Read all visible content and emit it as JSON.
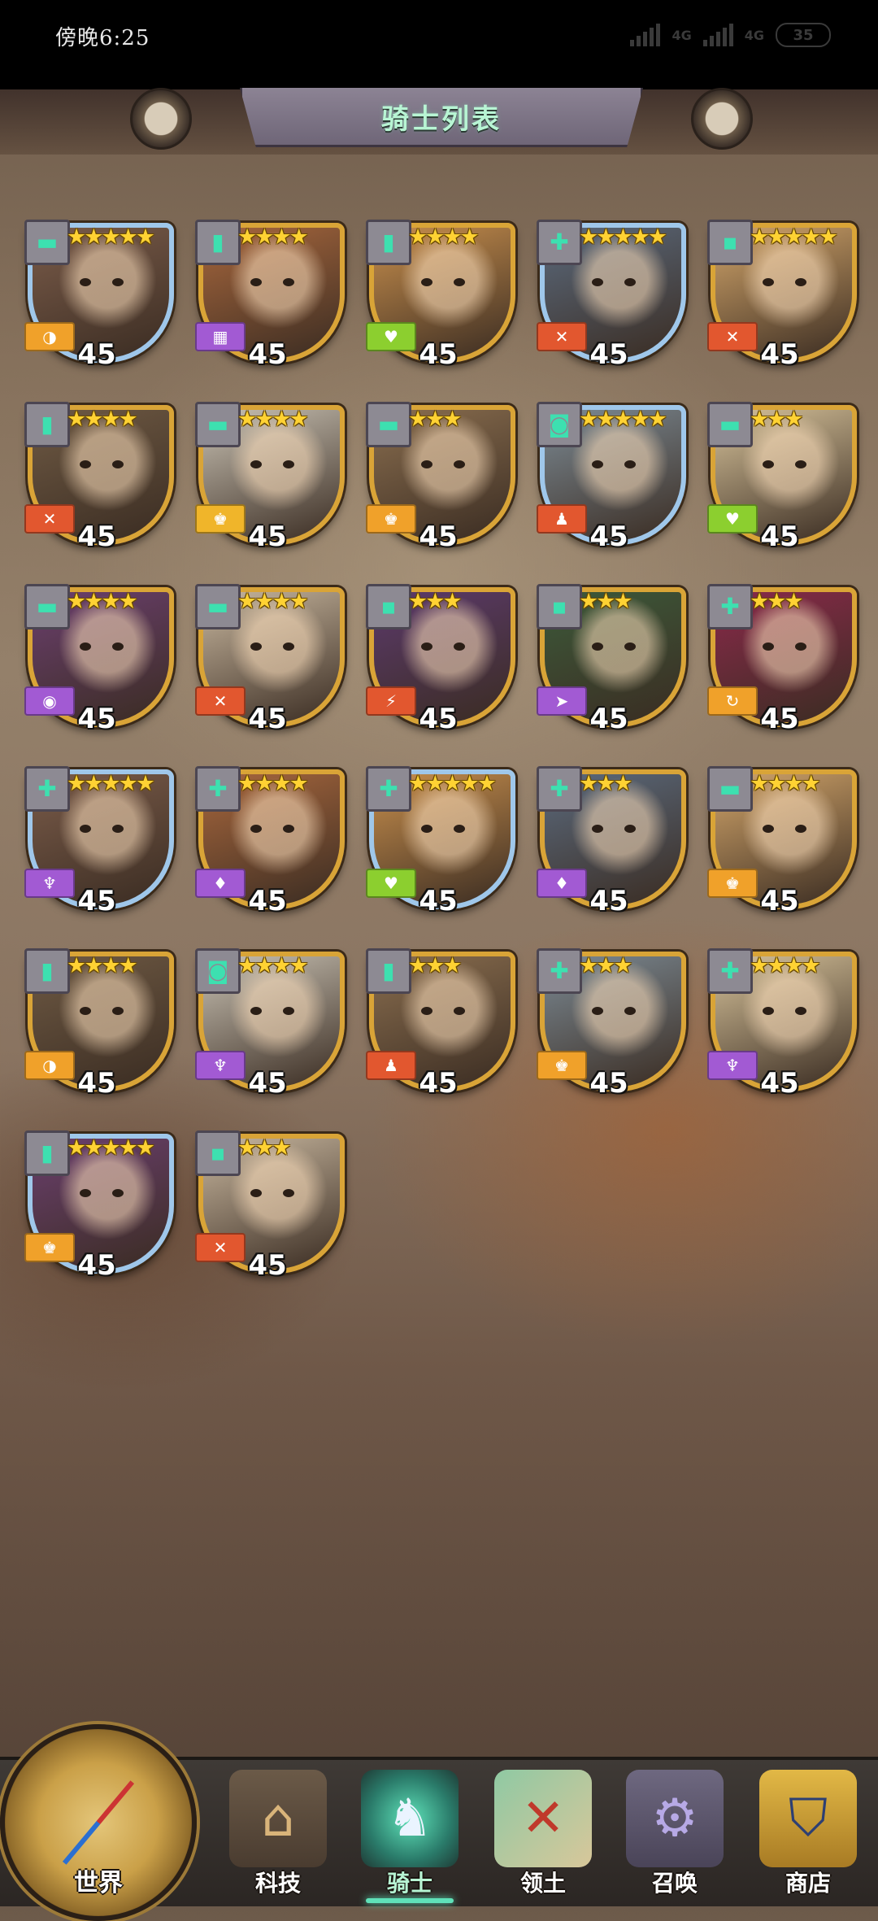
{
  "status_bar": {
    "time": "傍晚6:25",
    "network_1": "4G",
    "network_2": "4G",
    "battery": "35"
  },
  "header": {
    "title": "骑士列表"
  },
  "knights": [
    {
      "role": "▬",
      "stars": "★★★★★",
      "class_icon": "◑",
      "class_color": "#f0a12a",
      "level": "45",
      "frame": "blue"
    },
    {
      "role": "▮",
      "stars": "★★★★",
      "class_icon": "▦",
      "class_color": "#a25ad3",
      "level": "45",
      "frame": "gold"
    },
    {
      "role": "▮",
      "stars": "★★★★",
      "class_icon": "♥",
      "class_color": "#8ccf2f",
      "level": "45",
      "frame": "gold"
    },
    {
      "role": "✚",
      "stars": "★★★★★",
      "class_icon": "✕",
      "class_color": "#e2572f",
      "level": "45",
      "frame": "blue"
    },
    {
      "role": "▪",
      "stars": "★★★★★",
      "class_icon": "✕",
      "class_color": "#e2572f",
      "level": "45",
      "frame": "gold"
    },
    {
      "role": "▮",
      "stars": "★★★★",
      "class_icon": "✕",
      "class_color": "#e2572f",
      "level": "45",
      "frame": "gold"
    },
    {
      "role": "▬",
      "stars": "★★★★",
      "class_icon": "♚",
      "class_color": "#f0b52a",
      "level": "45",
      "frame": "gold"
    },
    {
      "role": "▬",
      "stars": "★★★",
      "class_icon": "♚",
      "class_color": "#f0a12a",
      "level": "45",
      "frame": "gold"
    },
    {
      "role": "◙",
      "stars": "★★★★★",
      "class_icon": "♟",
      "class_color": "#e2572f",
      "level": "45",
      "frame": "blue"
    },
    {
      "role": "▬",
      "stars": "★★★",
      "class_icon": "♥",
      "class_color": "#8ccf2f",
      "level": "45",
      "frame": "gold"
    },
    {
      "role": "▬",
      "stars": "★★★★",
      "class_icon": "◉",
      "class_color": "#a25ad3",
      "level": "45",
      "frame": "gold"
    },
    {
      "role": "▬",
      "stars": "★★★★",
      "class_icon": "✕",
      "class_color": "#e2572f",
      "level": "45",
      "frame": "gold"
    },
    {
      "role": "▪",
      "stars": "★★★",
      "class_icon": "⚡",
      "class_color": "#e2572f",
      "level": "45",
      "frame": "gold"
    },
    {
      "role": "▪",
      "stars": "★★★",
      "class_icon": "➤",
      "class_color": "#a25ad3",
      "level": "45",
      "frame": "gold"
    },
    {
      "role": "✚",
      "stars": "★★★",
      "class_icon": "↻",
      "class_color": "#f0a12a",
      "level": "45",
      "frame": "gold"
    },
    {
      "role": "✚",
      "stars": "★★★★★",
      "class_icon": "♆",
      "class_color": "#a25ad3",
      "level": "45",
      "frame": "blue"
    },
    {
      "role": "✚",
      "stars": "★★★★",
      "class_icon": "♦",
      "class_color": "#a25ad3",
      "level": "45",
      "frame": "gold"
    },
    {
      "role": "✚",
      "stars": "★★★★★",
      "class_icon": "♥",
      "class_color": "#8ccf2f",
      "level": "45",
      "frame": "blue"
    },
    {
      "role": "✚",
      "stars": "★★★",
      "class_icon": "♦",
      "class_color": "#a25ad3",
      "level": "45",
      "frame": "gold"
    },
    {
      "role": "▬",
      "stars": "★★★★",
      "class_icon": "♚",
      "class_color": "#f0a12a",
      "level": "45",
      "frame": "gold"
    },
    {
      "role": "▮",
      "stars": "★★★★",
      "class_icon": "◑",
      "class_color": "#f0a12a",
      "level": "45",
      "frame": "gold"
    },
    {
      "role": "◙",
      "stars": "★★★★",
      "class_icon": "♆",
      "class_color": "#a25ad3",
      "level": "45",
      "frame": "gold"
    },
    {
      "role": "▮",
      "stars": "★★★",
      "class_icon": "♟",
      "class_color": "#e2572f",
      "level": "45",
      "frame": "gold"
    },
    {
      "role": "✚",
      "stars": "★★★",
      "class_icon": "♚",
      "class_color": "#f0a12a",
      "level": "45",
      "frame": "gold"
    },
    {
      "role": "✚",
      "stars": "★★★★",
      "class_icon": "♆",
      "class_color": "#a25ad3",
      "level": "45",
      "frame": "gold"
    },
    {
      "role": "▮",
      "stars": "★★★★★",
      "class_icon": "♚",
      "class_color": "#f0a12a",
      "level": "45",
      "frame": "blue"
    },
    {
      "role": "▪",
      "stars": "★★★",
      "class_icon": "✕",
      "class_color": "#e2572f",
      "level": "45",
      "frame": "gold"
    }
  ],
  "nav": {
    "world": "世界",
    "tech": "科技",
    "knights": "骑士",
    "territory": "领土",
    "summon": "召唤",
    "shop": "商店"
  },
  "colors": {
    "accent": "#5fe2b9",
    "title_text": "#b8f5d4"
  }
}
